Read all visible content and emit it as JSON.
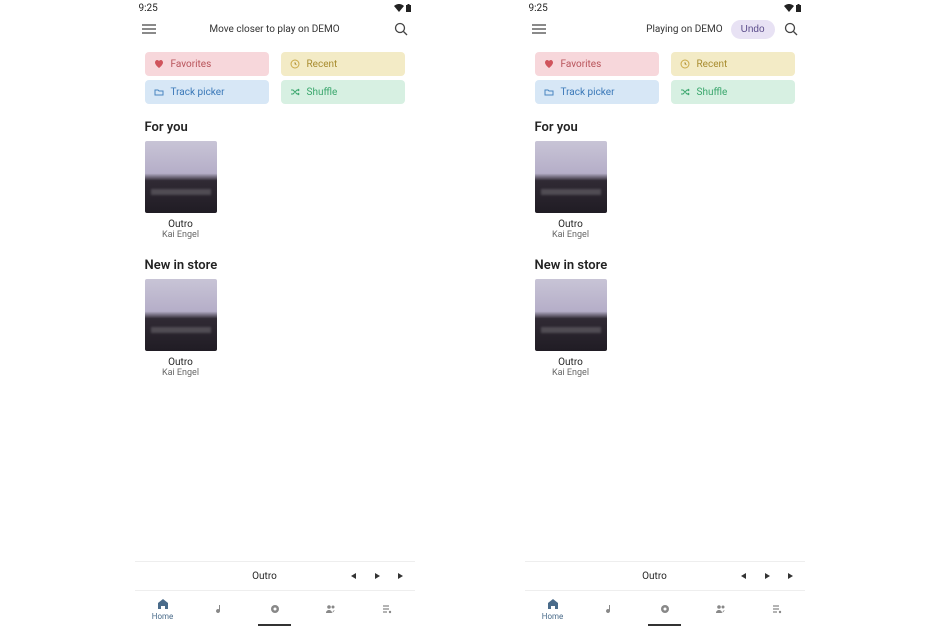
{
  "screens": [
    {
      "status_time": "9:25",
      "top_message": "Move closer to play on DEMO",
      "show_undo": false
    },
    {
      "status_time": "9:25",
      "top_message": "Playing on DEMO",
      "show_undo": true
    }
  ],
  "undo_label": "Undo",
  "chips": {
    "favorites": "Favorites",
    "recent": "Recent",
    "track_picker": "Track picker",
    "shuffle": "Shuffle"
  },
  "sections": {
    "for_you": {
      "title": "For you",
      "track": {
        "title": "Outro",
        "artist": "Kai Engel"
      }
    },
    "new_in_store": {
      "title": "New in store",
      "track": {
        "title": "Outro",
        "artist": "Kai Engel"
      }
    }
  },
  "mini_player": {
    "title": "Outro"
  },
  "nav": {
    "home": "Home"
  }
}
